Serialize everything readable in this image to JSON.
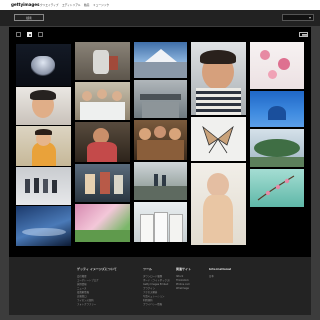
{
  "header": {
    "logo": "gettyimages",
    "nav": [
      "クリエイティブ",
      "エディトリアル",
      "動画",
      "ミュージック"
    ]
  },
  "subbar": {
    "button_label": "検索"
  },
  "footer": {
    "columns": [
      {
        "heading": "ゲッティ イメージズについて",
        "links": [
          "会社概要",
          "コーポレートブログ",
          "採用情報",
          "ニュース",
          "投資家情報",
          "広報窓口",
          "ライセンス契約",
          "フォトグラファー"
        ]
      },
      {
        "heading": "ツール",
        "links": [
          "ダウンロード履歴",
          "ボード（ライトボックス）",
          "Getty Images Embed",
          "プラグイン",
          "アクセス解析",
          "写真キュレーション",
          "利用規約",
          "プライバシー情報"
        ]
      },
      {
        "heading": "関連サイト",
        "links": [
          "iStock",
          "Thinkstock",
          "Photos.com",
          "WireImage"
        ]
      },
      {
        "heading": "International",
        "links": [
          "日本"
        ]
      }
    ]
  }
}
